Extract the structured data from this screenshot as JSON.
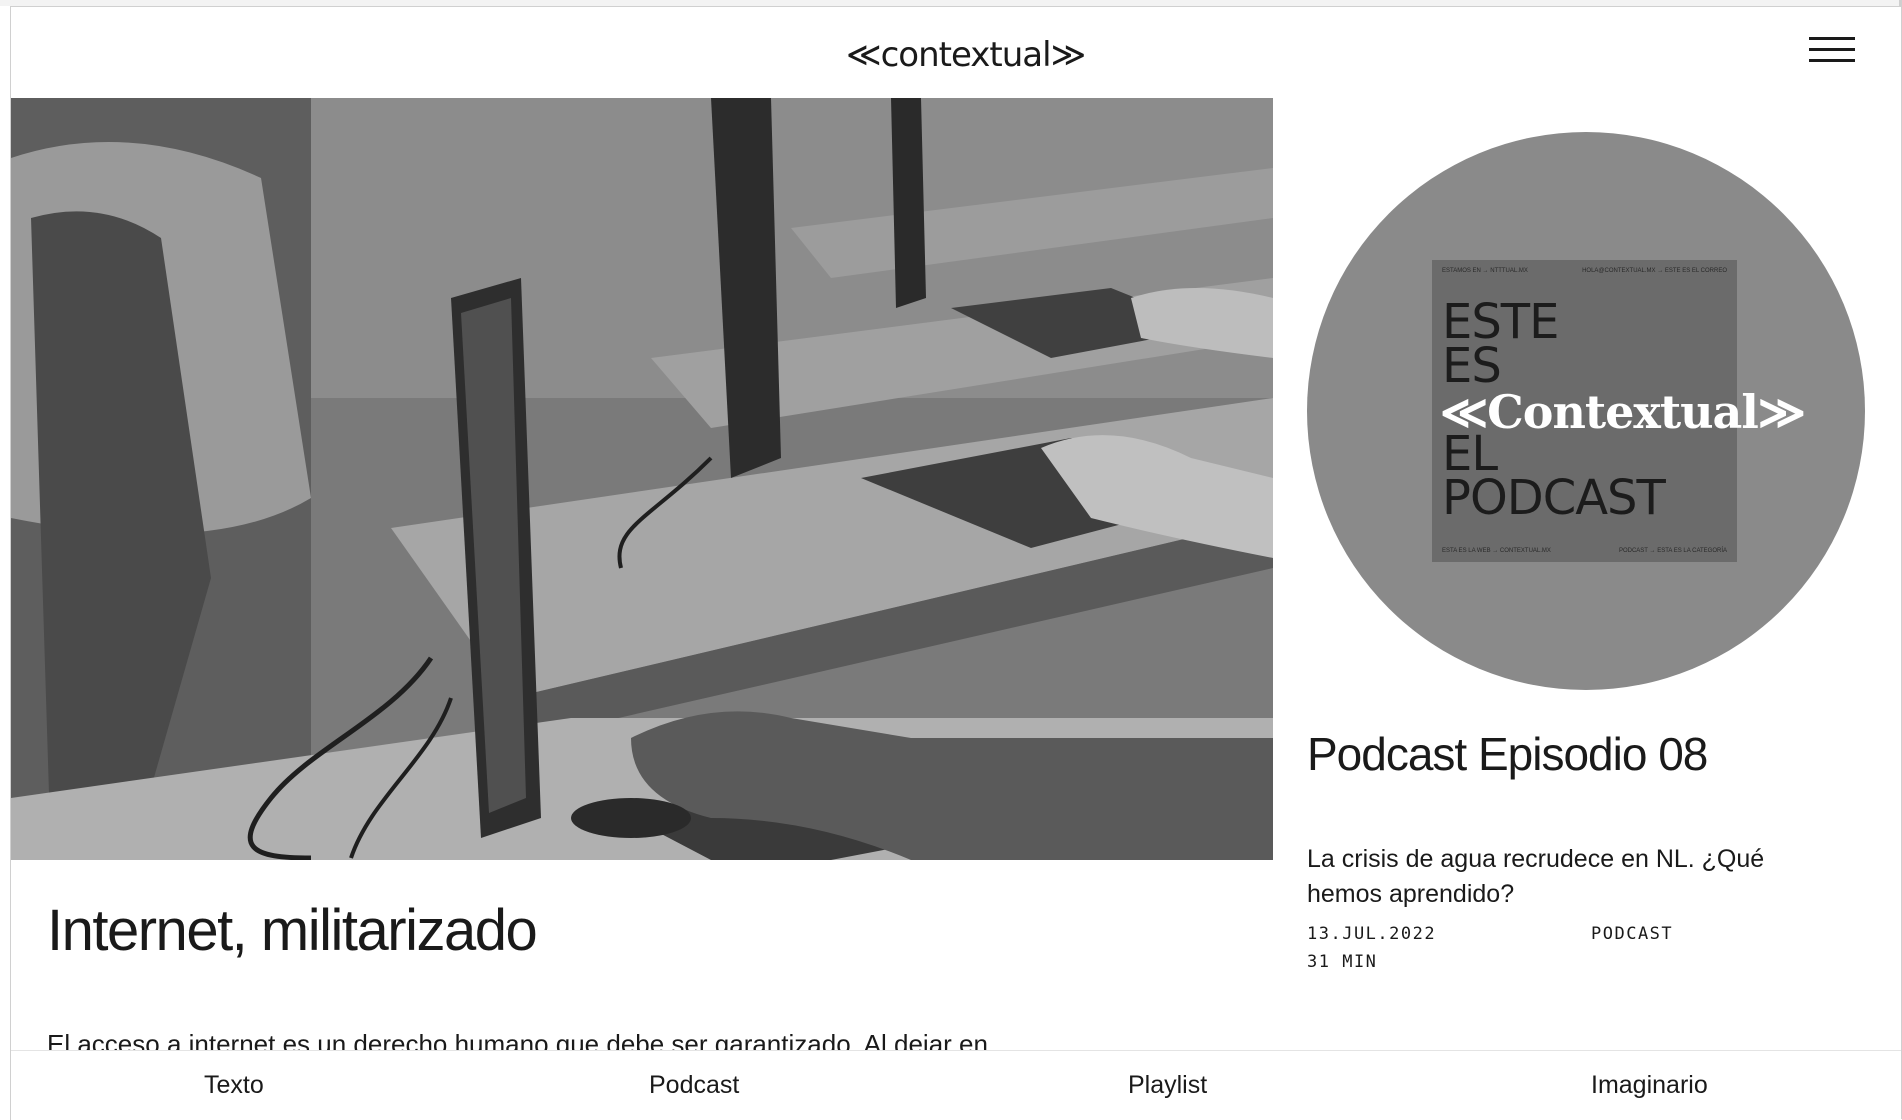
{
  "site": {
    "logo": "≪contextual≫"
  },
  "feature": {
    "title": "Internet, militarizado",
    "excerpt": "El acceso a internet es un derecho humano que debe ser garantizado. Al dejar en manos del Ejército también esta labor, el gobierno ignora un pasado oscuro"
  },
  "podcast": {
    "cover": {
      "top_left": "ESTAMOS EN → NTTTUAL.MX",
      "top_right": "HOLA@CONTEXTUAL.MX → ESTE ES EL CORREO",
      "line1": "ESTE",
      "line2": "ES",
      "brand": "≪Contextual≫",
      "line3": "EL",
      "line4": "PODCAST",
      "bottom_left": "ESTA ES LA WEB → CONTEXTUAL.MX",
      "bottom_right": "PODCAST → ESTA ES LA CATEGORÍA"
    },
    "title": "Podcast Episodio 08",
    "description": "La crisis de agua recrudece en NL. ¿Qué hemos aprendido?",
    "date": "13.JUL.2022",
    "duration": "31 MIN",
    "category": "PODCAST"
  },
  "nav": {
    "items": [
      "Texto",
      "Podcast",
      "Playlist",
      "Imaginario"
    ]
  },
  "icons": {
    "menu": "hamburger-menu-icon"
  }
}
